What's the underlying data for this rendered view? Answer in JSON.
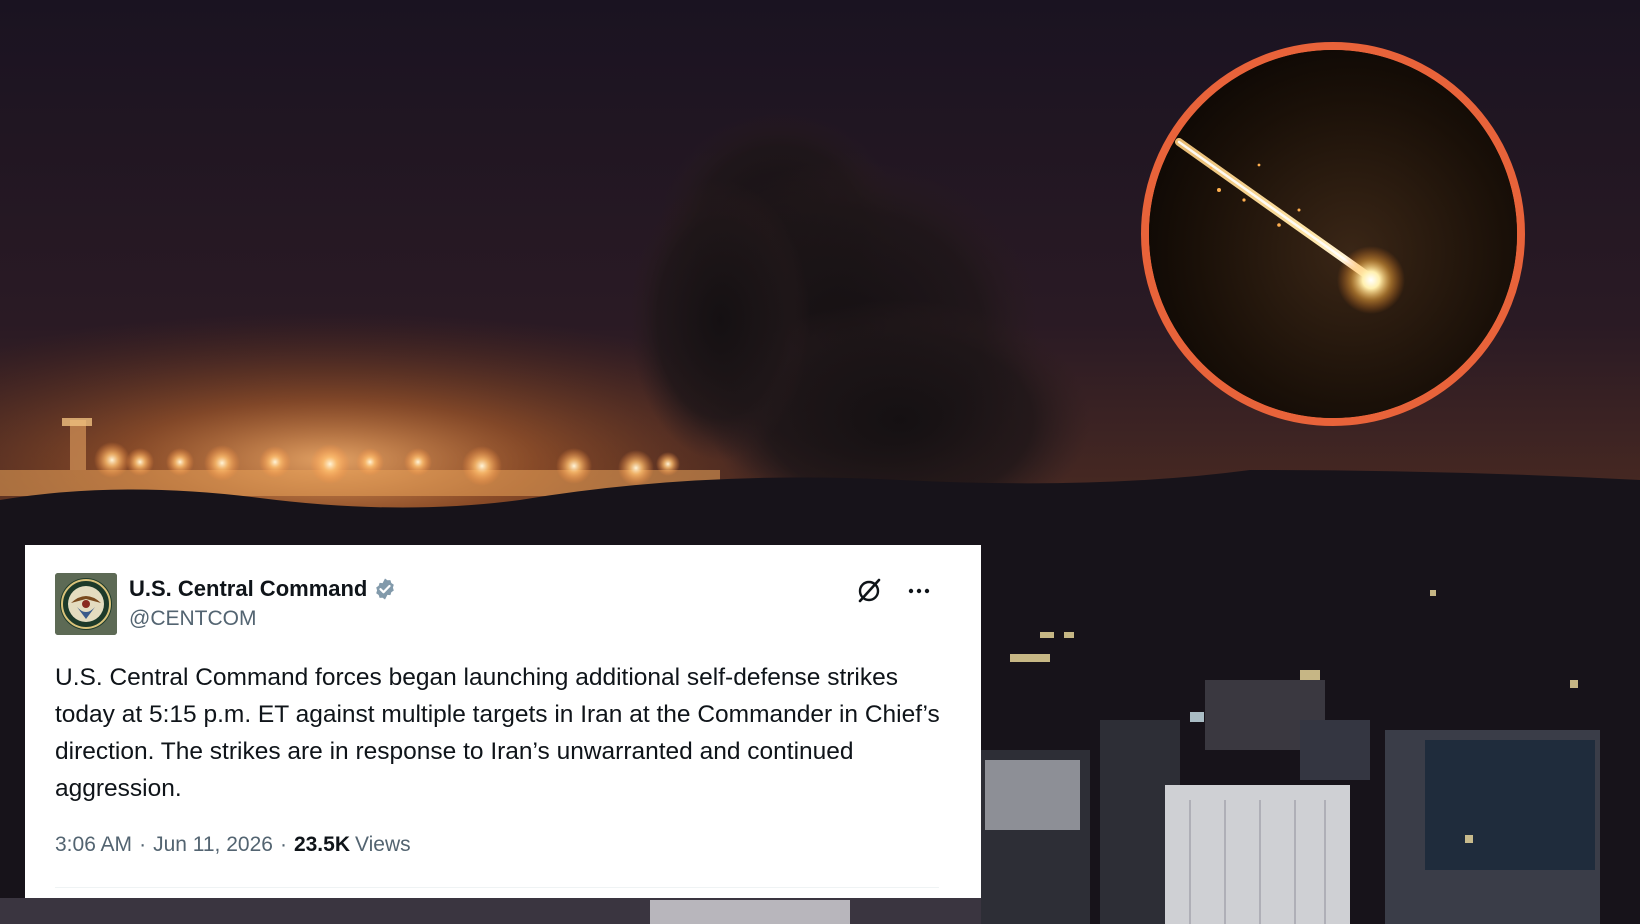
{
  "background": {
    "scene": "night-city-strike-smoke",
    "colors": {
      "sky_top": "#1b1422",
      "horizon_glow": "#e8893a",
      "smoke": "#1a1416"
    }
  },
  "inset": {
    "border_color": "#e8633a",
    "scene": "missile-streak-night"
  },
  "tweet": {
    "display_name": "U.S. Central Command",
    "handle": "@CENTCOM",
    "verified_icon": "verified-badge-icon",
    "verified_color": "#829aab",
    "text": "U.S. Central Command forces began launching additional self-defense strikes today at 5:15 p.m. ET against multiple targets in Iran at the Commander in Chief’s direction. The strikes are in response to Iran’s unwarranted and continued aggression.",
    "time": "3:06 AM",
    "date": "Jun 11, 2026",
    "separator": "·",
    "views_count": "23.5K",
    "views_label": "Views",
    "icons": {
      "grok": "grok-icon",
      "more": "more-options-icon"
    }
  }
}
